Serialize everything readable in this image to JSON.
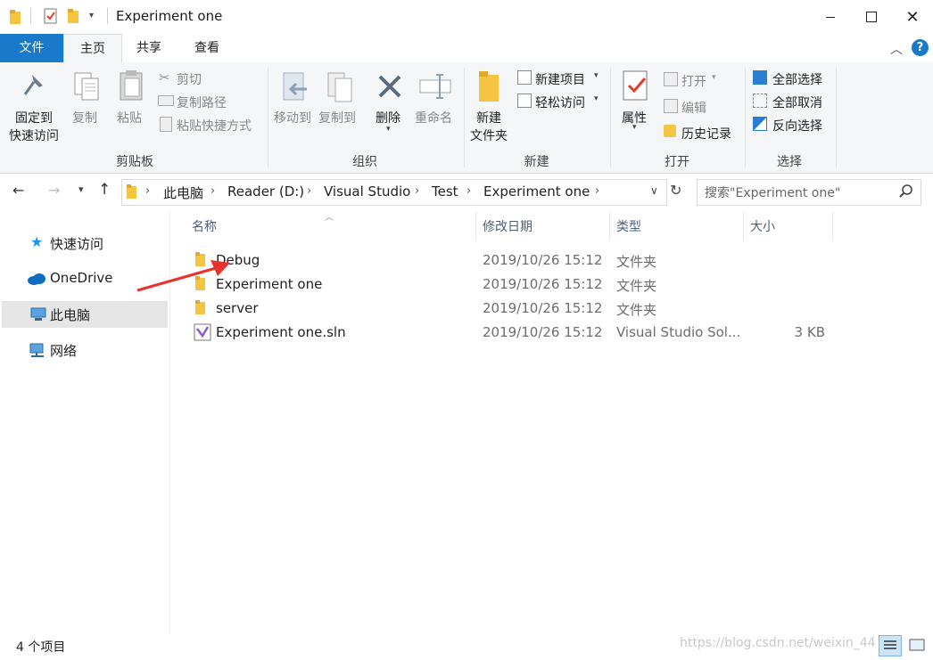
{
  "window": {
    "title": "Experiment one"
  },
  "ribbon_tabs": [
    "文件",
    "主页",
    "共享",
    "查看"
  ],
  "ribbon": {
    "clipboard": {
      "pin_line1": "固定到",
      "pin_line2": "快速访问",
      "copy": "复制",
      "paste": "粘贴",
      "cut": "剪切",
      "copy_path": "复制路径",
      "paste_shortcut": "粘贴快捷方式",
      "group": "剪贴板"
    },
    "organize": {
      "move_to": "移动到",
      "copy_to": "复制到",
      "delete": "删除",
      "rename": "重命名",
      "group": "组织"
    },
    "new": {
      "new_folder_line1": "新建",
      "new_folder_line2": "文件夹",
      "new_item": "新建项目",
      "easy_access": "轻松访问",
      "group": "新建"
    },
    "open": {
      "properties": "属性",
      "open": "打开",
      "edit": "编辑",
      "history": "历史记录",
      "group": "打开"
    },
    "select": {
      "select_all": "全部选择",
      "select_none": "全部取消",
      "invert": "反向选择",
      "group": "选择"
    }
  },
  "address": {
    "crumbs": [
      "此电脑",
      "Reader (D:)",
      "Visual Studio",
      "Test",
      "Experiment one"
    ],
    "search_placeholder": "搜索\"Experiment one\""
  },
  "nav": [
    {
      "label": "快速访问",
      "icon": "star-icon"
    },
    {
      "label": "OneDrive",
      "icon": "cloud-icon"
    },
    {
      "label": "此电脑",
      "icon": "computer-icon"
    },
    {
      "label": "网络",
      "icon": "network-icon"
    }
  ],
  "columns": [
    "名称",
    "修改日期",
    "类型",
    "大小"
  ],
  "files": [
    {
      "name": "Debug",
      "date": "2019/10/26 15:12",
      "type": "文件夹",
      "size": "",
      "icon": "folder-icon"
    },
    {
      "name": "Experiment one",
      "date": "2019/10/26 15:12",
      "type": "文件夹",
      "size": "",
      "icon": "folder-icon"
    },
    {
      "name": "server",
      "date": "2019/10/26 15:12",
      "type": "文件夹",
      "size": "",
      "icon": "folder-icon"
    },
    {
      "name": "Experiment one.sln",
      "date": "2019/10/26 15:12",
      "type": "Visual Studio Sol...",
      "size": "3 KB",
      "icon": "vs-solution-icon"
    }
  ],
  "status": {
    "count": "4 个项目"
  },
  "watermark": "https://blog.csdn.net/weixin_44",
  "colors": {
    "file_tab": "#1979ca",
    "folder": "#ffd65c",
    "arrow": "#e8322e"
  }
}
